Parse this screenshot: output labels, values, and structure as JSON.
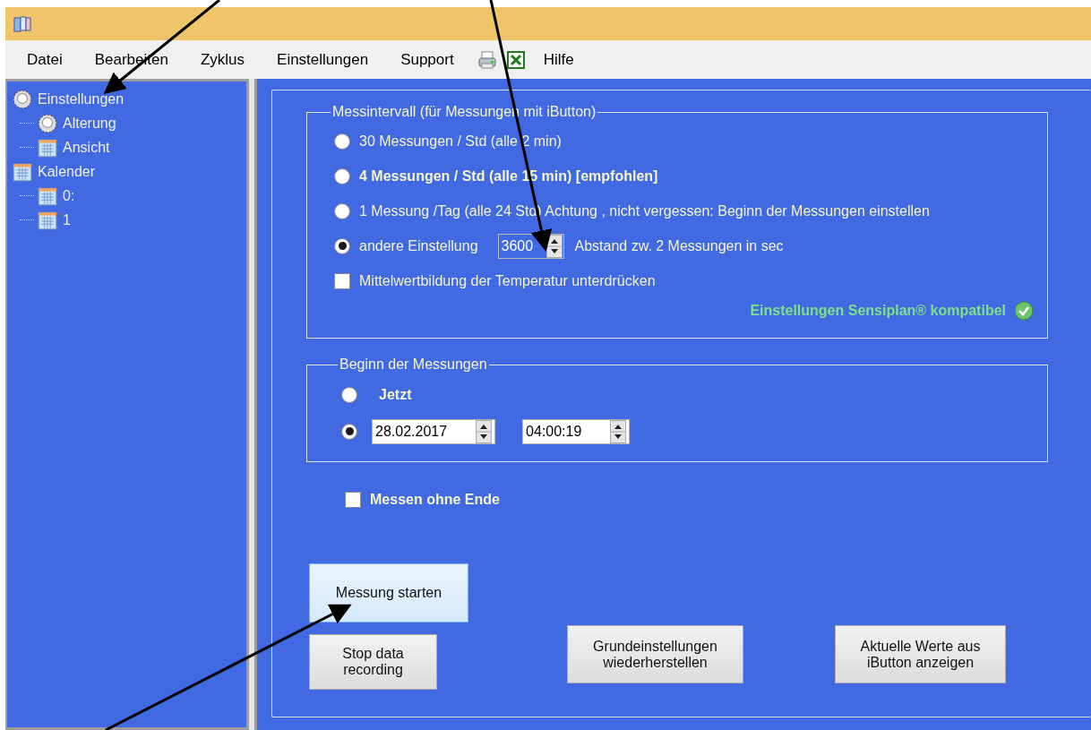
{
  "menu": {
    "items_left": [
      "Datei",
      "Bearbeiten",
      "Zyklus",
      "Einstellungen",
      "Support"
    ],
    "items_right": [
      "Hilfe"
    ]
  },
  "tree": [
    {
      "label": "Einstellungen",
      "kind": "gear",
      "children": [
        {
          "label": "Alterung",
          "kind": "gear"
        },
        {
          "label": "Ansicht",
          "kind": "calendar"
        }
      ]
    },
    {
      "label": "Kalender",
      "kind": "calendar",
      "children": [
        {
          "label": "0:",
          "kind": "calendar"
        },
        {
          "label": "1",
          "kind": "calendar"
        }
      ]
    }
  ],
  "interval": {
    "title": "Messintervall (für Messungen mit iButton)",
    "options": [
      {
        "kind": "plain",
        "label": "30 Messungen / Std (alle 2 min)",
        "selected": false,
        "emphasized": false
      },
      {
        "kind": "plain",
        "label": "4 Messungen / Std (alle 15 min) [empfohlen]",
        "selected": false,
        "emphasized": true
      },
      {
        "kind": "plain",
        "label": "1 Messung /Tag (alle 24 Std) Achtung , nicht vergessen: Beginn der Messungen einstellen",
        "selected": false,
        "emphasized": false
      },
      {
        "kind": "custom",
        "label": "andere Einstellung",
        "value": "3600",
        "suffix": "Abstand zw. 2 Messungen in sec",
        "selected": true,
        "emphasized": false
      }
    ],
    "checkbox": {
      "label": "Mittelwertbildung der Temperatur unterdrücken",
      "checked": false
    },
    "compat": {
      "label": "Einstellungen Sensiplan® kompatibel",
      "ok": true
    }
  },
  "start": {
    "title": "Beginn der Messungen",
    "options": [
      {
        "kind": "now",
        "label": "Jetzt",
        "selected": false
      },
      {
        "kind": "datetime",
        "date": "28.02.2017",
        "time": "04:00:19",
        "selected": true
      }
    ]
  },
  "endless": {
    "label": "Messen ohne Ende",
    "checked": false
  },
  "buttons": [
    {
      "label": "Messung starten",
      "highlighted": true
    },
    {
      "label": "Stop data\nrecording",
      "highlighted": false
    },
    {
      "label": "Grundeinstellungen\nwiederherstellen",
      "highlighted": false
    },
    {
      "label": "Aktuelle Werte aus\niButton anzeigen",
      "highlighted": false
    }
  ]
}
